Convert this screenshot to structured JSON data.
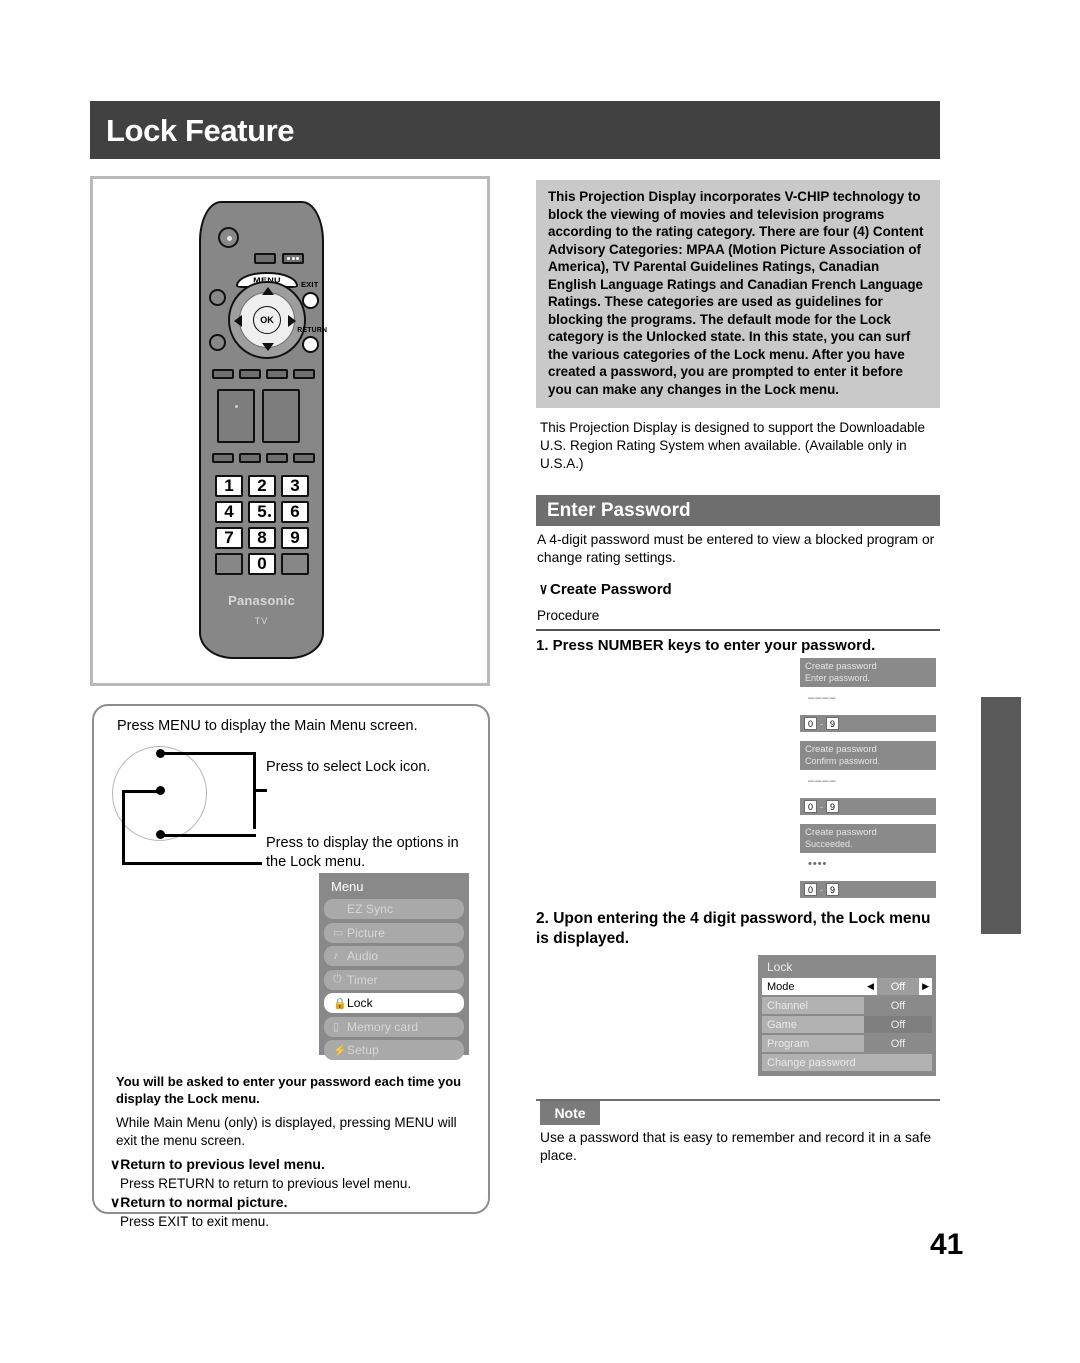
{
  "page": {
    "title": "Lock Feature",
    "number": "41"
  },
  "vchip": {
    "paragraph": "This Projection Display incorporates V-CHIP technology to block the viewing of movies and television programs according to the rating category. There are four (4) Content Advisory Categories: MPAA (Motion Picture Association of America), TV Parental Guidelines Ratings, Canadian English Language Ratings and Canadian French Language Ratings. These categories are used as guidelines for blocking the programs. The default mode for the Lock category is the Unlocked state. In this state, you can surf the various categories of the Lock menu. After you have created a password, you are prompted to enter it before you can make any changes in the Lock menu."
  },
  "support": {
    "text": "This Projection Display is designed to support the  Downloadable U.S. Region Rating System  when available. (Available only in U.S.A.)"
  },
  "enter_password": {
    "heading": "Enter Password",
    "intro": "A 4-digit password must be entered to view a blocked program or change rating settings.",
    "create_heading": "Create Password",
    "create_chevron": "∨",
    "procedure_label": "Procedure",
    "step1": "1. Press NUMBER keys to enter your password.",
    "step2": "2. Upon entering the 4 digit password, the Lock menu is displayed."
  },
  "password_osd": [
    {
      "title": "Create password",
      "subtitle": "Enter password.",
      "dots": "––––",
      "key_low": "0",
      "dash": "-",
      "key_high": "9"
    },
    {
      "title": "Create password",
      "subtitle": "Confirm password.",
      "dots": "––––",
      "key_low": "0",
      "dash": "-",
      "key_high": "9"
    },
    {
      "title": "Create password",
      "subtitle": "Succeeded.",
      "dots": "••••",
      "key_low": "0",
      "dash": "-",
      "key_high": "9"
    }
  ],
  "lock_osd": {
    "title": "Lock",
    "left_arrow": "◀",
    "right_arrow": "▶",
    "rows": [
      {
        "name": "Mode",
        "value": "Off",
        "selected": true
      },
      {
        "name": "Channel",
        "value": "Off",
        "selected": false
      },
      {
        "name": "Game",
        "value": "Off",
        "selected": false
      },
      {
        "name": "Program",
        "value": "Off",
        "selected": false
      }
    ],
    "last_row": "Change password"
  },
  "note": {
    "label": "Note",
    "text": "Use a password that is easy to remember and record it in a safe place."
  },
  "menu_panel": {
    "line1": "Press MENU to display the Main Menu screen.",
    "line2": "Press to select  Lock  icon.",
    "line3": "Press to display the options in the Lock menu.",
    "bold_note": "You will be asked to enter your password each time you display the Lock menu.",
    "normal_note": "While Main Menu (only) is displayed, pressing MENU will exit the menu screen.",
    "return_prev_heading": "Return to previous level menu.",
    "return_prev_text": "Press RETURN to return to previous level menu.",
    "return_normal_heading": "Return to normal picture.",
    "return_normal_text": "Press EXIT to exit menu.",
    "chevron": "∨"
  },
  "menu_osd": {
    "title": "Menu",
    "items": [
      {
        "label": "EZ Sync",
        "glyph": "",
        "selected": false
      },
      {
        "label": "Picture",
        "glyph": "▭",
        "selected": false
      },
      {
        "label": "Audio",
        "glyph": "♪",
        "selected": false
      },
      {
        "label": "Timer",
        "glyph": "⏻",
        "selected": false
      },
      {
        "label": "Lock",
        "glyph": "ὑ2",
        "selected": true
      },
      {
        "label": "Memory card",
        "glyph": "▯",
        "selected": false
      },
      {
        "label": "Setup",
        "glyph": "⚡",
        "selected": false
      }
    ]
  },
  "remote": {
    "menu_label": "MENU",
    "ok_label": "OK",
    "exit_label": "EXIT",
    "return_label": "RETURN",
    "brand": "Panasonic",
    "mode": "TV",
    "keys": [
      "1",
      "2",
      "3",
      "4",
      "5",
      "6",
      "7",
      "8",
      "9",
      "",
      "0",
      ""
    ]
  },
  "colors": {
    "title_bar": "#414141",
    "section_bar": "#6e6e6e",
    "vchip_box": "#c9c9c9",
    "osd_gray": "#8a8a8a",
    "side_tab": "#595959"
  }
}
